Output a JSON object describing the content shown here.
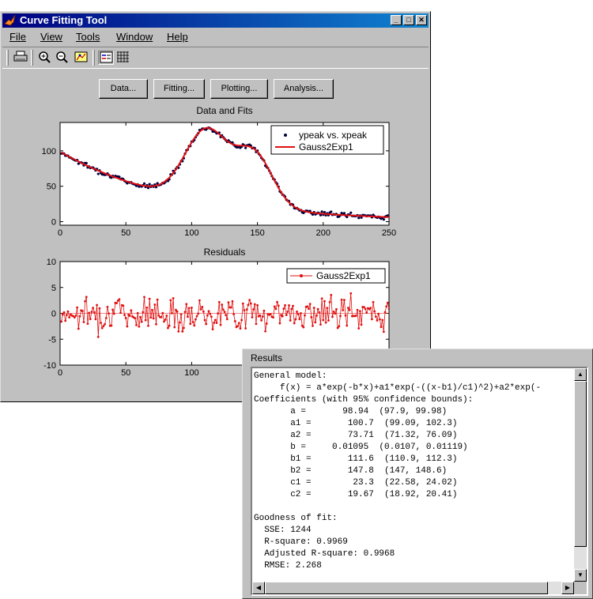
{
  "window": {
    "title": "Curve Fitting Tool",
    "controls": {
      "minimize": "_",
      "maximize": "□",
      "close": "✕"
    }
  },
  "menu": [
    "File",
    "View",
    "Tools",
    "Window",
    "Help"
  ],
  "toolbar": {
    "icons": [
      "print-icon",
      "zoom-in-icon",
      "zoom-out-icon",
      "data-cursor-icon",
      "legend-icon",
      "grid-icon"
    ]
  },
  "buttons": {
    "data": "Data...",
    "fitting": "Fitting...",
    "plotting": "Plotting...",
    "analysis": "Analysis..."
  },
  "colors": {
    "fit_line": "#e01010",
    "data_points": "#000040",
    "residuals": "#e01010"
  },
  "charts": [
    {
      "type": "line",
      "title": "Data and Fits",
      "xlim": [
        0,
        250
      ],
      "ylim": [
        -5,
        140
      ],
      "xticks": [
        0,
        50,
        100,
        150,
        200,
        250
      ],
      "yticks": [
        0,
        50,
        100
      ],
      "legend": {
        "placement": "top-right",
        "entries": [
          "ypeak vs. xpeak",
          "Gauss2Exp1"
        ]
      }
    },
    {
      "type": "line",
      "title": "Residuals",
      "xlim": [
        0,
        250
      ],
      "ylim": [
        -10,
        10
      ],
      "xticks": [
        0,
        50,
        100,
        150,
        200,
        250
      ],
      "yticks": [
        10,
        5,
        0,
        -5,
        -10
      ],
      "legend": {
        "placement": "top-right",
        "entries": [
          "Gauss2Exp1"
        ]
      }
    }
  ],
  "chart_data": {
    "type": "line",
    "model": {
      "a": 98.94,
      "a1": 100.7,
      "a2": 73.71,
      "b": 0.01095,
      "b1": 111.6,
      "b2": 147.8,
      "c1": 23.3,
      "c2": 19.67
    },
    "x_range": [
      1,
      250
    ],
    "fit_series": "Gauss2Exp1",
    "data_series": "ypeak vs. xpeak",
    "residual_rmse": 2.268
  },
  "results": {
    "title": "Results",
    "text": "General model:\n     f(x) = a*exp(-b*x)+a1*exp(-((x-b1)/c1)^2)+a2*exp(-\nCoefficients (with 95% confidence bounds):\n       a =       98.94  (97.9, 99.98)\n       a1 =       100.7  (99.09, 102.3)\n       a2 =       73.71  (71.32, 76.09)\n       b =     0.01095  (0.0107, 0.01119)\n       b1 =       111.6  (110.9, 112.3)\n       b2 =       147.8  (147, 148.6)\n       c1 =        23.3  (22.58, 24.02)\n       c2 =       19.67  (18.92, 20.41)\n\nGoodness of fit:\n  SSE: 1244\n  R-square: 0.9969\n  Adjusted R-square: 0.9968\n  RMSE: 2.268"
  }
}
